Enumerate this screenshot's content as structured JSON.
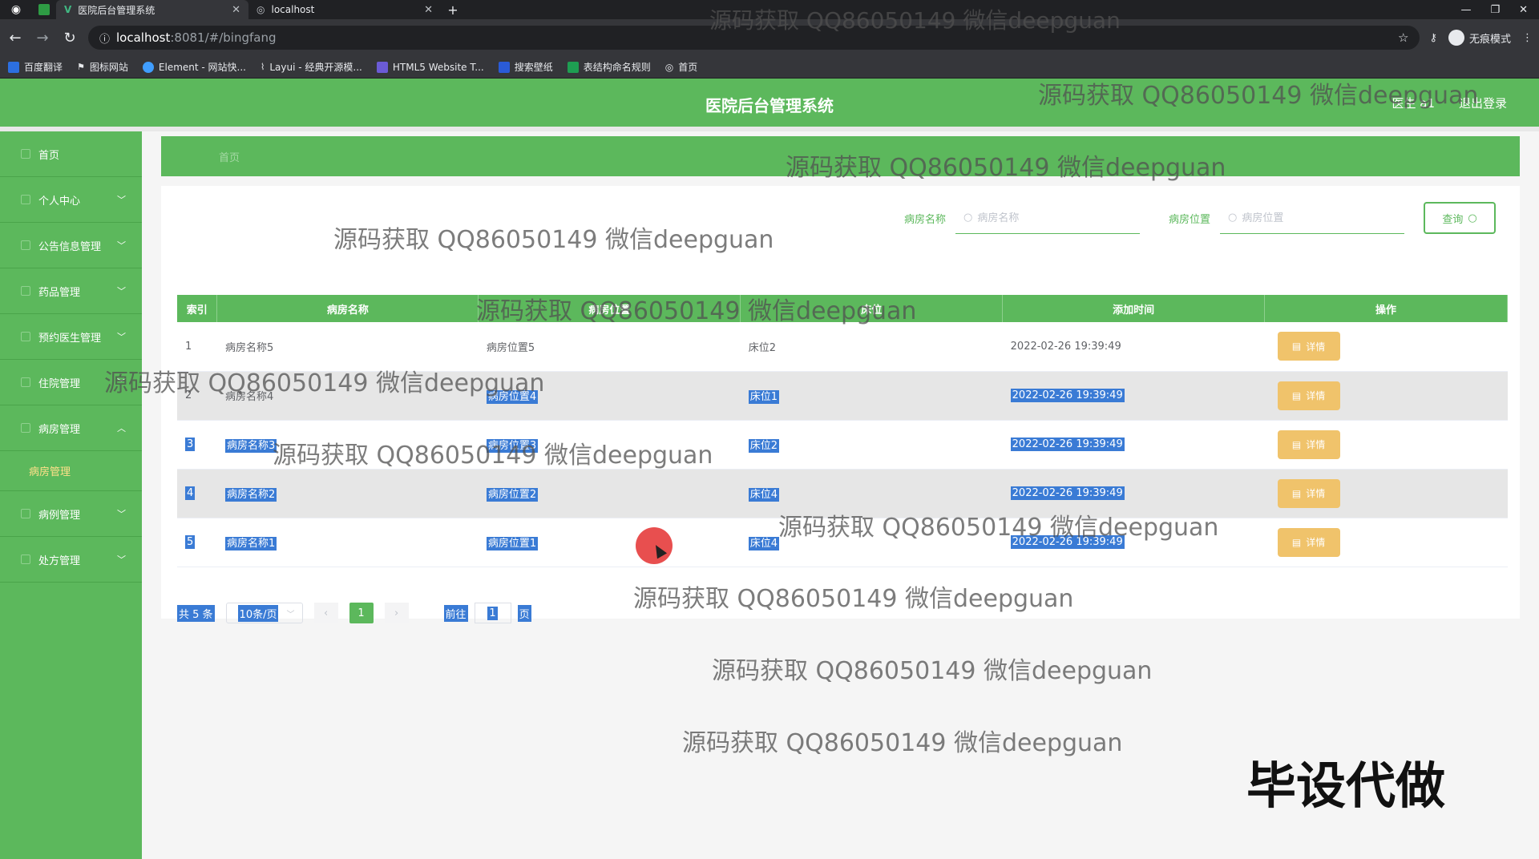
{
  "browser": {
    "tabs": [
      {
        "title": "医院后台管理系统",
        "favicon": "V",
        "active": true
      },
      {
        "title": "localhost",
        "favicon": "globe-icon",
        "active": false
      }
    ],
    "url_host": "localhost",
    "url_rest": ":8081/#/bingfang",
    "profile_label": "无痕模式",
    "bookmarks": [
      "百度翻译",
      "图标网站",
      "Element - 网站快...",
      "Layui - 经典开源模...",
      "HTML5 Website T...",
      "搜索壁纸",
      "表结构命名规则",
      "首页"
    ]
  },
  "header": {
    "title": "医院后台管理系统",
    "user": "医生 a1",
    "logout": "退出登录"
  },
  "sidebar": {
    "items": [
      {
        "label": "首页",
        "has_children": false
      },
      {
        "label": "个人中心",
        "has_children": true
      },
      {
        "label": "公告信息管理",
        "has_children": true
      },
      {
        "label": "药品管理",
        "has_children": true
      },
      {
        "label": "预约医生管理",
        "has_children": true
      },
      {
        "label": "住院管理",
        "has_children": true
      },
      {
        "label": "病房管理",
        "has_children": true,
        "expanded": true
      },
      {
        "label": "病例管理",
        "has_children": true
      },
      {
        "label": "处方管理",
        "has_children": true
      }
    ],
    "subitem": "病房管理"
  },
  "breadcrumb": "首页",
  "search": {
    "name_label": "病房名称",
    "name_placeholder": "病房名称",
    "location_label": "病房位置",
    "location_placeholder": "病房位置",
    "query_button": "查询"
  },
  "table": {
    "columns": [
      "索引",
      "病房名称",
      "病房位置",
      "床位",
      "添加时间",
      "操作"
    ],
    "rows": [
      {
        "index": "1",
        "name": "病房名称5",
        "location": "病房位置5",
        "bed": "床位2",
        "time": "2022-02-26 19:39:49",
        "action": "详情"
      },
      {
        "index": "2",
        "name": "病房名称4",
        "location": "病房位置4",
        "bed": "床位1",
        "time": "2022-02-26 19:39:49",
        "action": "详情"
      },
      {
        "index": "3",
        "name": "病房名称3",
        "location": "病房位置3",
        "bed": "床位2",
        "time": "2022-02-26 19:39:49",
        "action": "详情"
      },
      {
        "index": "4",
        "name": "病房名称2",
        "location": "病房位置2",
        "bed": "床位4",
        "time": "2022-02-26 19:39:49",
        "action": "详情"
      },
      {
        "index": "5",
        "name": "病房名称1",
        "location": "病房位置1",
        "bed": "床位4",
        "time": "2022-02-26 19:39:49",
        "action": "详情"
      }
    ]
  },
  "pagination": {
    "total": "共 5 条",
    "page_size": "10条/页",
    "current_page": "1",
    "goto_prefix": "前往",
    "goto_value": "1",
    "goto_suffix": "页"
  },
  "watermark": "源码获取 QQ86050149 微信deepguan",
  "promo": "毕设代做",
  "colors": {
    "theme": "#5cb85c",
    "detail_button": "#f0c36b",
    "selection": "#3a7bd5"
  }
}
